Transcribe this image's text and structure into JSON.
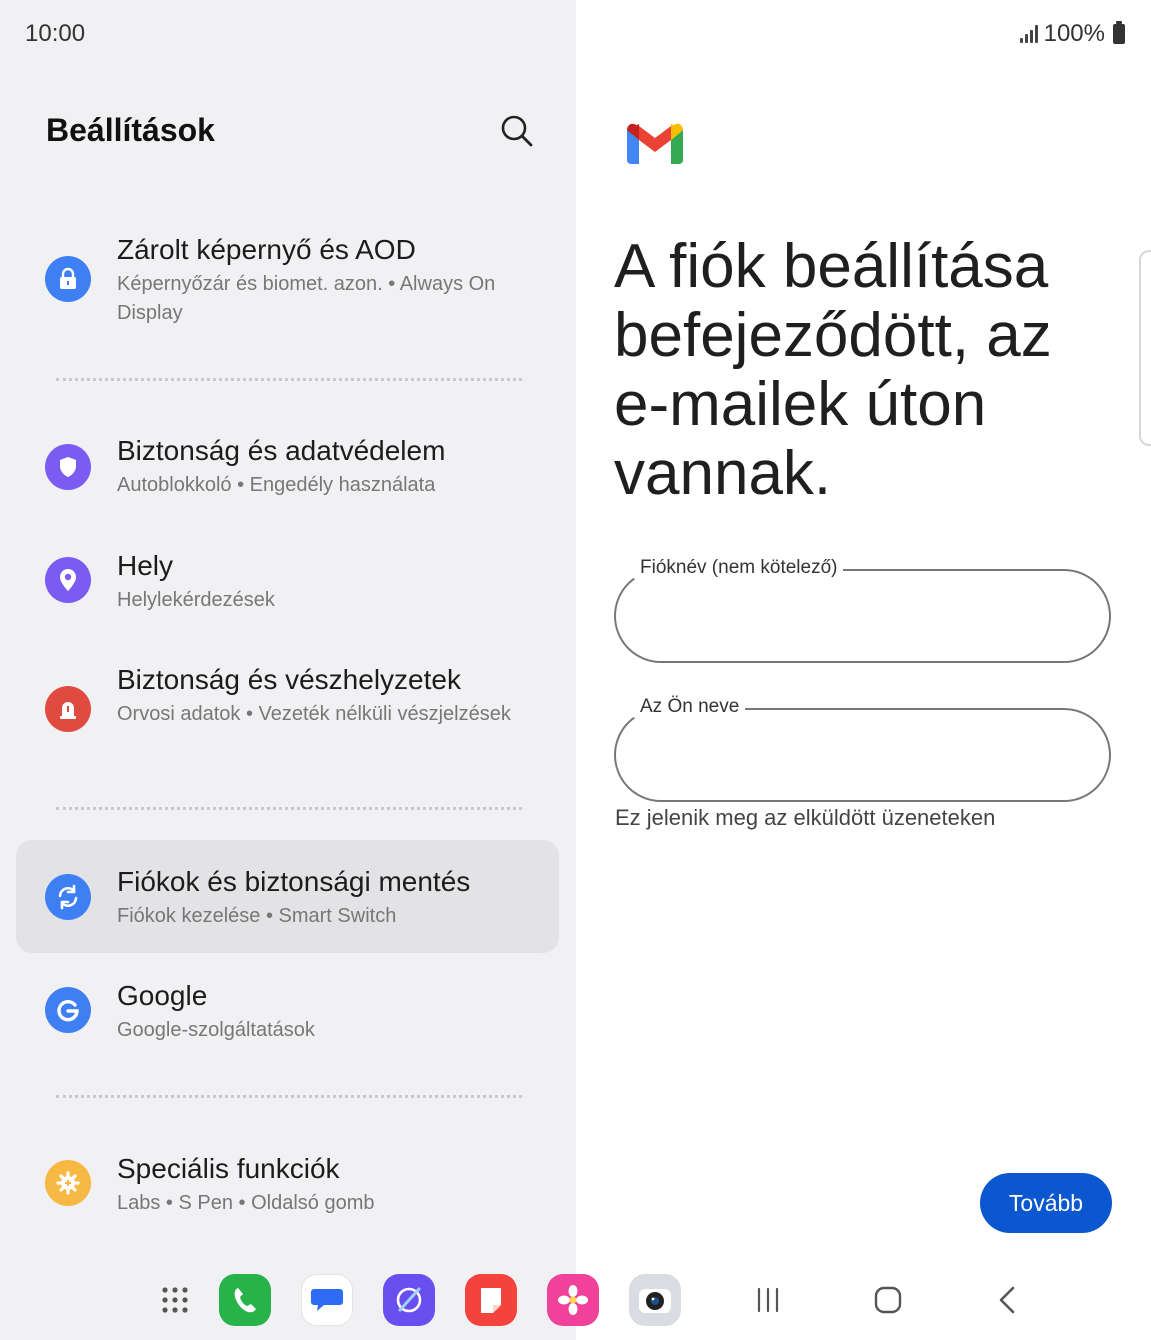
{
  "status": {
    "time": "10:00",
    "battery": "100%"
  },
  "settings": {
    "title": "Beállítások",
    "items": [
      {
        "title": "Zárolt képernyő és AOD",
        "subtitle": "Képernyőzár és biomet. azon.  •  Always On Display",
        "color": "#3f7ff4"
      },
      {
        "title": "Biztonság és adatvédelem",
        "subtitle": "Autoblokkoló  •  Engedély használata",
        "color": "#7b5cf2"
      },
      {
        "title": "Hely",
        "subtitle": "Helylekérdezések",
        "color": "#7b5cf2"
      },
      {
        "title": "Biztonság és vészhelyzetek",
        "subtitle": "Orvosi adatok  •  Vezeték nélküli vészjelzések",
        "color": "#e14a3e"
      },
      {
        "title": "Fiókok és biztonsági mentés",
        "subtitle": "Fiókok kezelése  •  Smart Switch",
        "color": "#3f7ff4"
      },
      {
        "title": "Google",
        "subtitle": "Google-szolgáltatások",
        "color": "#3f7ff4"
      },
      {
        "title": "Speciális funkciók",
        "subtitle": "Labs  •  S Pen  •  Oldalsó gomb",
        "color": "#f7b844"
      }
    ]
  },
  "gmail": {
    "headline": "A fiók beállítása befejeződött, az e-mailek úton vannak.",
    "account_name_label": "Fióknév (nem kötelező)",
    "account_name_value": "",
    "your_name_label": "Az Ön neve",
    "your_name_value": "",
    "hint": "Ez jelenik meg az elküldött üzeneteken",
    "next_label": "Tovább",
    "accent": "#0b57d0"
  },
  "dock": {
    "apps": [
      "apps-grid-icon",
      "phone-icon",
      "messages-icon",
      "internet-icon",
      "notes-icon",
      "gallery-icon",
      "camera-icon"
    ],
    "nav": [
      "recents-icon",
      "home-icon",
      "back-icon"
    ]
  }
}
